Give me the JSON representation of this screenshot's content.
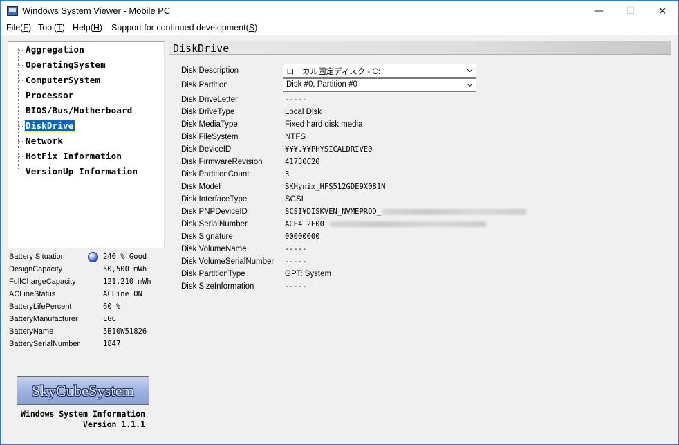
{
  "window": {
    "title": "Windows System Viewer - Mobile PC",
    "minimize_glyph": "—",
    "maximize_glyph": "☐",
    "close_glyph": "✕"
  },
  "menu": [
    {
      "label": "File(",
      "key": "F",
      "tail": ")"
    },
    {
      "label": "Tool(",
      "key": "T",
      "tail": ")"
    },
    {
      "label": "Help(",
      "key": "H",
      "tail": ")"
    },
    {
      "label": "Support for continued development(",
      "key": "S",
      "tail": ")"
    }
  ],
  "tree": {
    "items": [
      "Aggregation",
      "OperatingSystem",
      "ComputerSystem",
      "Processor",
      "BIOS/Bus/Motherboard",
      "DiskDrive",
      "Network",
      "HotFix Information",
      "VersionUp Information"
    ],
    "selected": "DiskDrive"
  },
  "battery": [
    {
      "key": "Battery Situation",
      "value": "240 % Good",
      "orb": true
    },
    {
      "key": "DesignCapacity",
      "value": "50,500 mWh"
    },
    {
      "key": "FullChargeCapacity",
      "value": "121,210 mWh"
    },
    {
      "key": "ACLineStatus",
      "value": "ACLine ON"
    },
    {
      "key": "BatteryLifePercent",
      "value": "60 %"
    },
    {
      "key": "BatteryManufacturer",
      "value": "LGC"
    },
    {
      "key": "BatteryName",
      "value": "5B10W51826"
    },
    {
      "key": "BatterySerialNumber",
      "value": "1847"
    }
  ],
  "logo": {
    "text": "SkyCubeSystem",
    "line1": "Windows System Information",
    "line2": "Version 1.1.1"
  },
  "section": {
    "title": "DiskDrive"
  },
  "disk": {
    "description_label": "Disk Description",
    "description_value": "ローカル固定ディスク - C:",
    "partition_label": "Disk Partition",
    "partition_value": "Disk #0, Partition #0",
    "props": [
      {
        "key": "Disk DriveLetter",
        "value": "-----"
      },
      {
        "key": "Disk DriveType",
        "value": "Local Disk",
        "sans": true
      },
      {
        "key": "Disk MediaType",
        "value": "Fixed hard disk media",
        "sans": true
      },
      {
        "key": "Disk FileSystem",
        "value": "NTFS",
        "sans": true
      },
      {
        "key": "Disk DeviceID",
        "value": "¥¥¥.¥¥PHYSICALDRIVE0"
      },
      {
        "key": "Disk FirmwareRevision",
        "value": "41730C20"
      },
      {
        "key": "Disk PartitionCount",
        "value": "3"
      },
      {
        "key": "Disk Model",
        "value": "SKHynix_HFS512GDE9X081N"
      },
      {
        "key": "Disk InterfaceType",
        "value": "SCSI",
        "sans": true
      },
      {
        "key": "Disk PNPDeviceID",
        "value": "SCSI¥DISKVEN_NVMEPROD_",
        "blur": 208
      },
      {
        "key": "Disk SerialNumber",
        "value": "ACE4_2E00_",
        "blur": 226
      },
      {
        "key": "Disk Signature",
        "value": "00000000"
      },
      {
        "key": "Disk VolumeName",
        "value": "-----"
      },
      {
        "key": "Disk VolumeSerialNumber",
        "value": "-----"
      },
      {
        "key": "Disk PartitionType",
        "value": "GPT: System",
        "sans": true
      },
      {
        "key": "Disk SizeInformation",
        "value": "-----"
      }
    ]
  }
}
